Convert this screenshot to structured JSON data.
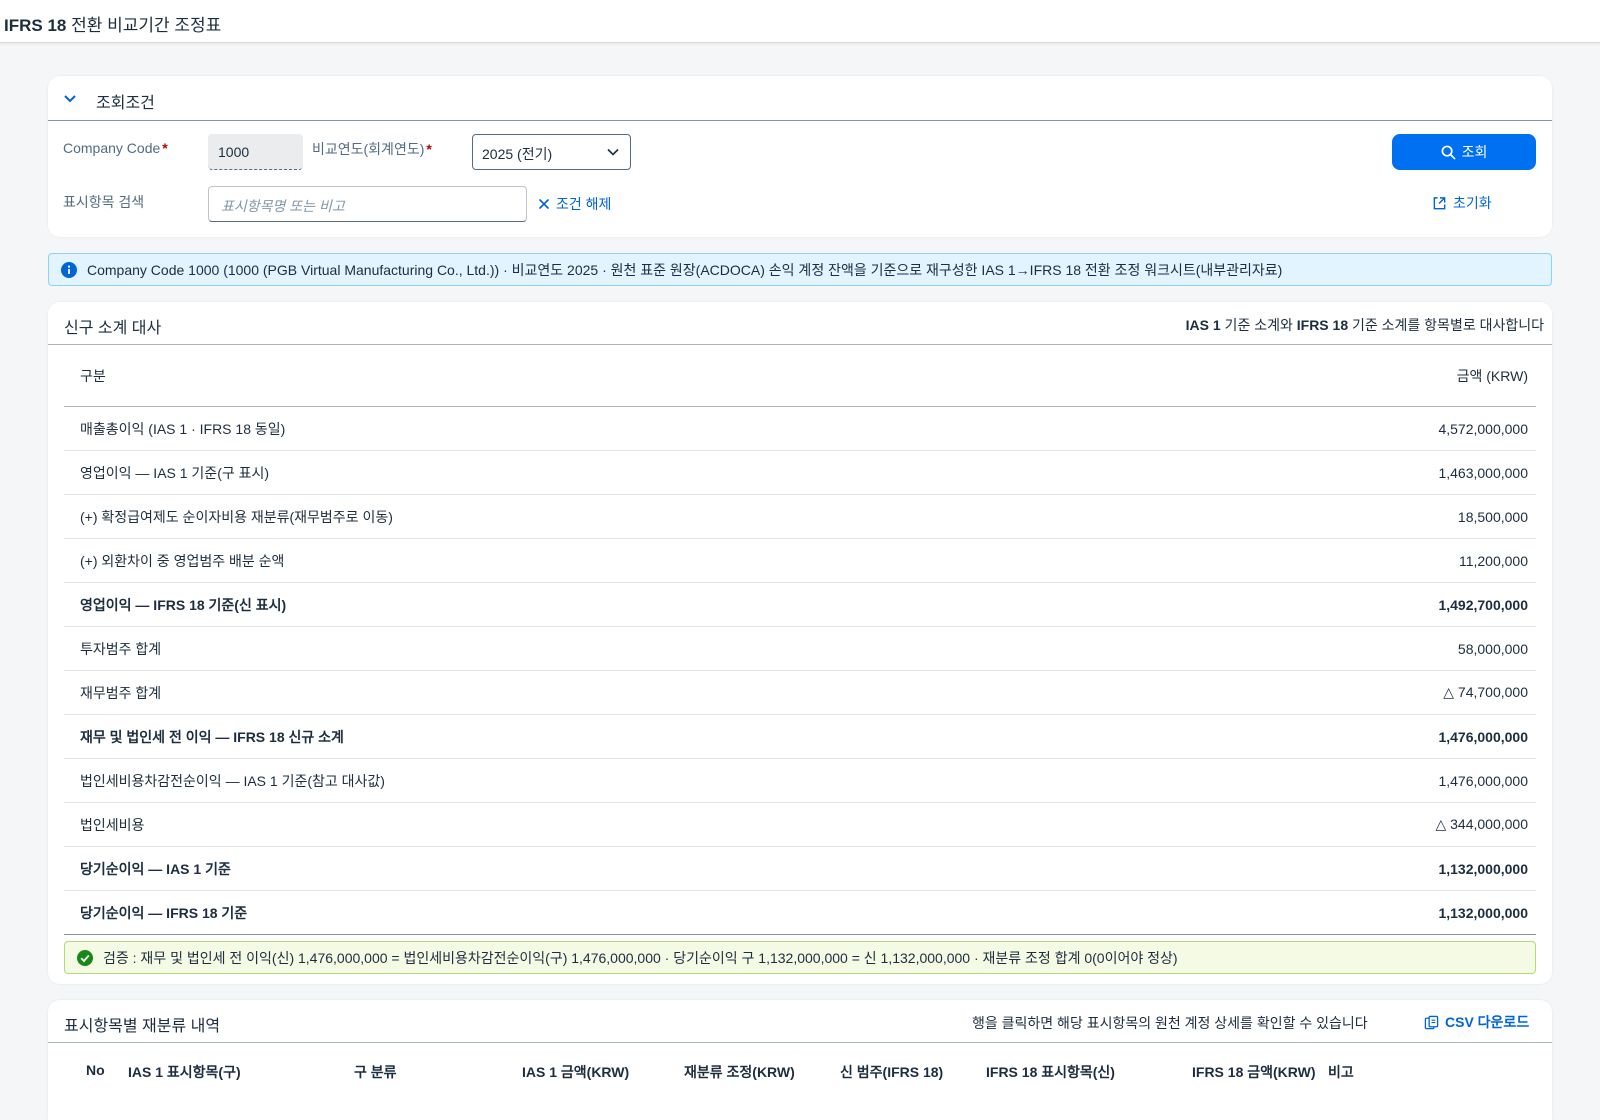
{
  "app": {
    "title_bold": "IFRS 18",
    "title_rest": " 전환 비교기간 조정표"
  },
  "filter": {
    "header": "조회조건",
    "company_code_label": "Company Code",
    "company_code_value": "1000",
    "year_label": "비교연도(회계연도)",
    "year_value": "2025 (전기)",
    "item_search_label": "표시항목 검색",
    "item_search_placeholder": "표시항목명 또는 비고",
    "clear_label": "조건 해제",
    "go_label": "조회",
    "reset_label": "초기화",
    "required_mark": "*"
  },
  "info": {
    "text": "Company Code 1000 (1000 (PGB Virtual Manufacturing Co., Ltd.)) · 비교연도 2025 · 원천 표준 원장(ACDOCA) 손익 계정 잔액을 기준으로 재구성한 IAS 1→IFRS 18 전환 조정 워크시트(내부관리자료)"
  },
  "summary": {
    "title": "신구 소계 대사",
    "note_b1": "IAS 1",
    "note_t1": " 기준 소계와 ",
    "note_b2": "IFRS 18",
    "note_t2": " 기준 소계를 항목별로 대사합니다",
    "col_label": "구분",
    "col_amount": "금액 (KRW)",
    "rows": [
      {
        "label": "매출총이익 (IAS 1 · IFRS 18 동일)",
        "amount": "4,572,000,000",
        "bold": false
      },
      {
        "label": "영업이익 — IAS 1 기준(구 표시)",
        "amount": "1,463,000,000",
        "bold": false
      },
      {
        "label": "(+) 확정급여제도 순이자비용 재분류(재무범주로 이동)",
        "amount": "18,500,000",
        "bold": false
      },
      {
        "label": "(+) 외환차이 중 영업범주 배분 순액",
        "amount": "11,200,000",
        "bold": false
      },
      {
        "label": "영업이익 — IFRS 18 기준(신 표시)",
        "amount": "1,492,700,000",
        "bold": true
      },
      {
        "label": "투자범주 합계",
        "amount": "58,000,000",
        "bold": false
      },
      {
        "label": "재무범주 합계",
        "amount": "△ 74,700,000",
        "bold": false
      },
      {
        "label": "재무 및 법인세 전 이익 — IFRS 18 신규 소계",
        "amount": "1,476,000,000",
        "bold": true
      },
      {
        "label": "법인세비용차감전순이익 — IAS 1 기준(참고 대사값)",
        "amount": "1,476,000,000",
        "bold": false
      },
      {
        "label": "법인세비용",
        "amount": "△ 344,000,000",
        "bold": false
      },
      {
        "label": "당기순이익 — IAS 1 기준",
        "amount": "1,132,000,000",
        "bold": true
      },
      {
        "label": "당기순이익 — IFRS 18 기준",
        "amount": "1,132,000,000",
        "bold": true
      }
    ],
    "check_text": "검증 : 재무 및 법인세 전 이익(신) 1,476,000,000 = 법인세비용차감전순이익(구) 1,476,000,000 · 당기순이익 구 1,132,000,000 = 신 1,132,000,000 · 재분류 조정 합계 0(0이어야 정상)"
  },
  "reclass": {
    "title": "표시항목별 재분류 내역",
    "note": "행을 클릭하면 해당 표시항목의 원천 계정 상세를 확인할 수 있습니다",
    "csv_label": "CSV 다운로드",
    "columns": [
      "No",
      "IAS 1 표시항목(구)",
      "구 분류",
      "IAS 1 금액(KRW)",
      "재분류 조정(KRW)",
      "신 범주(IFRS 18)",
      "IFRS 18 표시항목(신)",
      "IFRS 18 금액(KRW)",
      "비고"
    ]
  },
  "colors": {
    "accent": "#0070f2",
    "info_bg": "#e1f4ff",
    "check_bg": "#f5fae5",
    "success": "#188918",
    "required": "#aa0808"
  },
  "icons": [
    "chevron-down-icon",
    "search-icon",
    "close-icon",
    "reset-icon",
    "info-icon",
    "check-icon",
    "export-icon",
    "dropdown-icon"
  ]
}
